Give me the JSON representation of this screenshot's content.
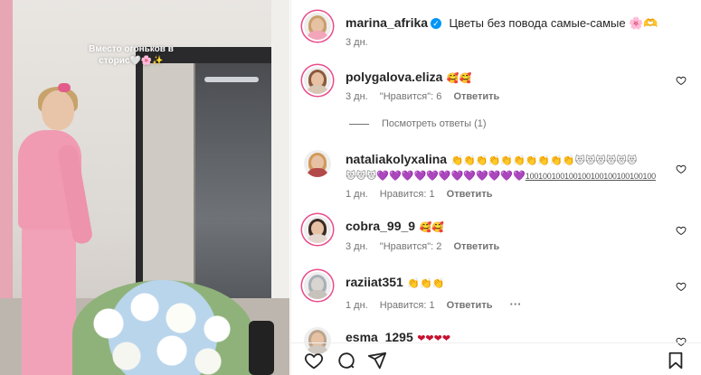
{
  "media": {
    "caption": "Вместо огоньков в сторис🤍🌸✨"
  },
  "post": {
    "author": "marina_afrika",
    "caption": "Цветы без повода самые-самые 🌸🫶",
    "age": "3 дн."
  },
  "comments": [
    {
      "username": "polygalova.eliza",
      "emoji": "🥰🥰",
      "age": "3 дн.",
      "likes": "\"Нравится\": 6",
      "reply_label": "Ответить",
      "view_replies": "Посмотреть ответы (1)"
    },
    {
      "username": "nataliakolyxalina",
      "hands": "👏👏👏👏👏👏👏👏👏👏",
      "cats": "😻😻😻😻😻😻",
      "cats2": "😻😻😻",
      "hearts": "💜💜💜💜💜💜💜💜💜💜💜💜",
      "digits": "100100100100100100100100100100",
      "age": "1 дн.",
      "likes": "Нравится: 1",
      "reply_label": "Ответить"
    },
    {
      "username": "cobra_99_9",
      "emoji": "🥰🥰",
      "age": "3 дн.",
      "likes": "\"Нравится\": 2",
      "reply_label": "Ответить"
    },
    {
      "username": "raziiat351",
      "emoji": "👏👏👏",
      "age": "1 дн.",
      "likes": "Нравится: 1",
      "reply_label": "Ответить",
      "more": "···"
    },
    {
      "username": "esma_1295",
      "emoji": "❤❤❤❤"
    }
  ],
  "colors": {
    "accent_ring": "#e94b8a",
    "verified": "#0095f6",
    "meta_text": "#737373"
  },
  "icons": [
    "heart-icon",
    "comment-icon",
    "share-icon",
    "bookmark-icon",
    "verified-icon"
  ]
}
